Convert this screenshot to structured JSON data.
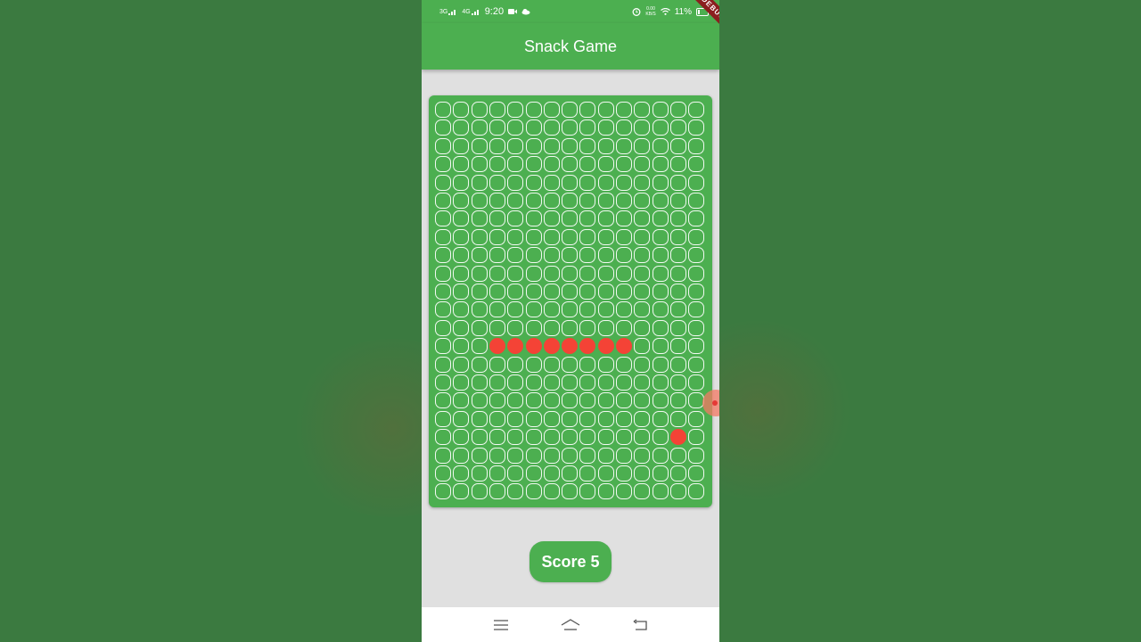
{
  "status_bar": {
    "time": "9:20",
    "network_1": "3G",
    "network_2": "4G",
    "data_speed_value": "0.00",
    "data_speed_unit": "KB/S",
    "battery": "11%"
  },
  "app_bar": {
    "title": "Snack Game"
  },
  "debug_banner": "DEBUG",
  "board": {
    "columns": 15,
    "rows": 22,
    "snake": [
      [
        13,
        3
      ],
      [
        13,
        4
      ],
      [
        13,
        5
      ],
      [
        13,
        6
      ],
      [
        13,
        7
      ],
      [
        13,
        8
      ],
      [
        13,
        9
      ],
      [
        13,
        10
      ]
    ],
    "food": [
      18,
      13
    ]
  },
  "score": {
    "label": "Score 5"
  },
  "colors": {
    "primary": "#4caf50",
    "snake": "#f44336",
    "food": "#f44336",
    "background": "#e0e0e0"
  },
  "icons": {
    "nav_menu": "menu-icon",
    "nav_home": "home-icon",
    "nav_back": "back-icon"
  }
}
